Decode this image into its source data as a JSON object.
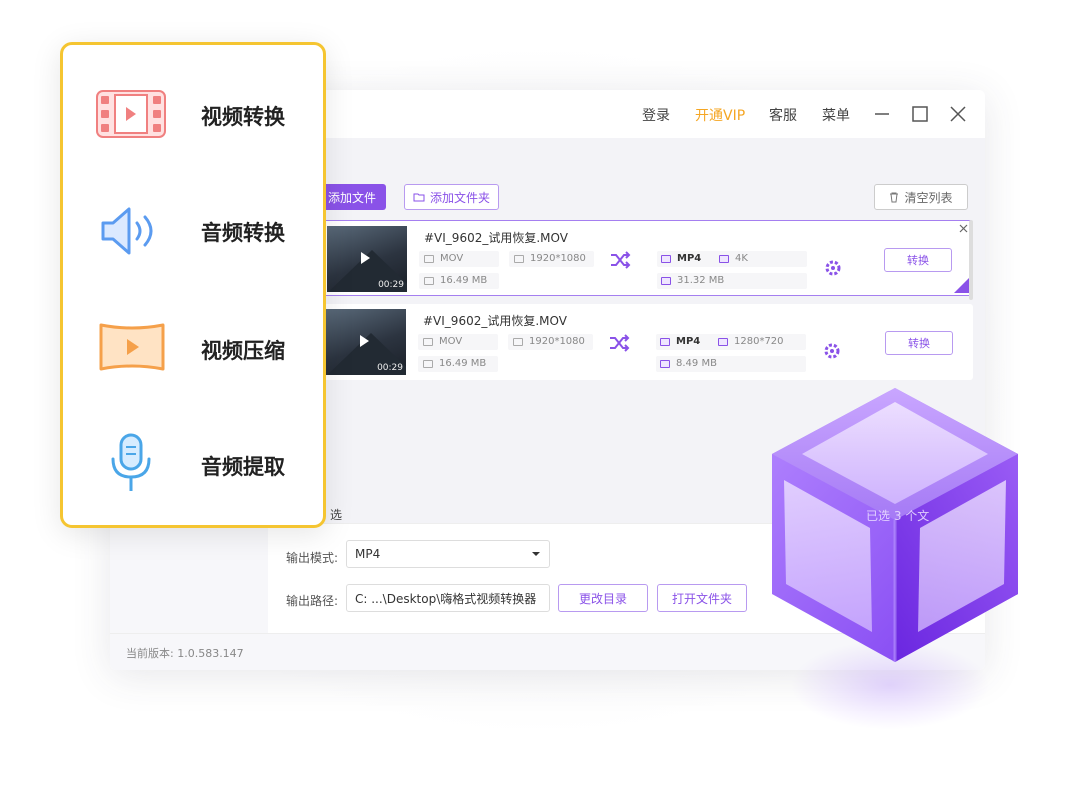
{
  "titlebar": {
    "login": "登录",
    "vip": "开通VIP",
    "service": "客服",
    "menu": "菜单"
  },
  "toolbar": {
    "add_file": "添加文件",
    "add_folder": "添加文件夹",
    "clear_list": "清空列表"
  },
  "files": [
    {
      "name": "#VI_9602_试用恢复.MOV",
      "duration": "00:29",
      "src_format": "MOV",
      "src_resolution": "1920*1080",
      "src_size": "16.49 MB",
      "out_format": "MP4",
      "out_resolution": "4K",
      "out_size": "31.32 MB",
      "action": "转换"
    },
    {
      "name": "#VI_9602_试用恢复.MOV",
      "duration": "00:29",
      "src_format": "MOV",
      "src_resolution": "1920*1080",
      "src_size": "16.49 MB",
      "out_format": "MP4",
      "out_resolution": "1280*720",
      "out_size": "8.49 MB",
      "action": "转换"
    }
  ],
  "output": {
    "mode_label": "输出模式:",
    "mode_value": "MP4",
    "path_label": "输出路径:",
    "path_value": "C: ...\\Desktop\\嗨格式视频转换器",
    "change_dir": "更改目录",
    "open_folder": "打开文件夹",
    "partial_label": "选",
    "selected_text": "已选 3 个文"
  },
  "footer": {
    "version": "当前版本: 1.0.583.147"
  },
  "feature_menu": {
    "items": [
      {
        "label": "视频转换",
        "icon": "video-film-icon"
      },
      {
        "label": "音频转换",
        "icon": "speaker-icon"
      },
      {
        "label": "视频压缩",
        "icon": "video-compress-icon"
      },
      {
        "label": "音频提取",
        "icon": "microphone-icon"
      }
    ]
  },
  "colors": {
    "accent": "#8a52e8",
    "vip": "#f5a623",
    "menu_border": "#f5c531"
  }
}
